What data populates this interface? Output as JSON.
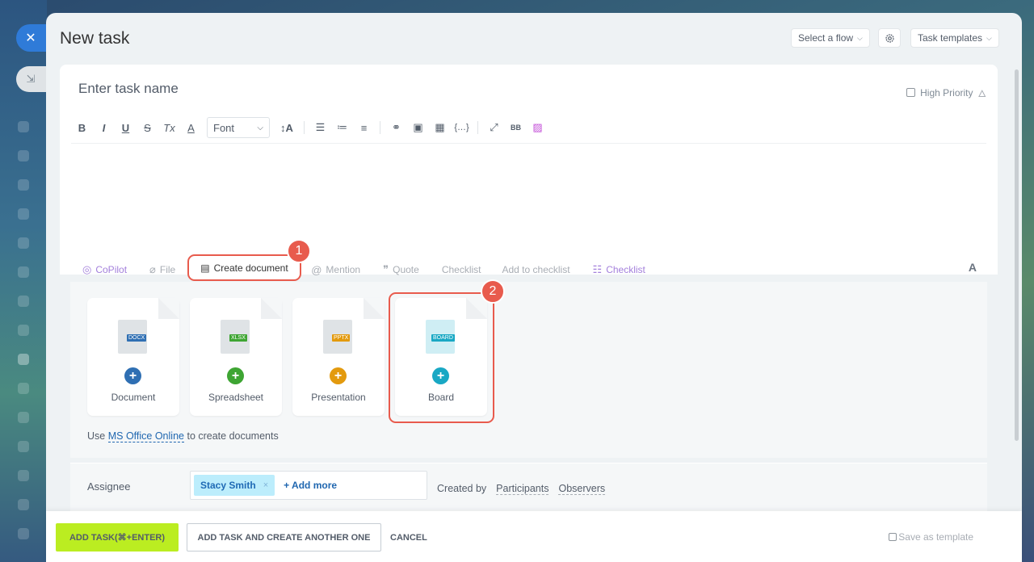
{
  "header": {
    "title": "New task",
    "select_flow": "Select a flow",
    "task_templates": "Task templates"
  },
  "sidebar": {
    "close_icon": "close-icon",
    "collapse_icon": "collapse-icon"
  },
  "editor": {
    "task_name_placeholder": "Enter task name",
    "high_priority": "High Priority",
    "toolbar": {
      "bold": "B",
      "italic": "I",
      "underline": "U",
      "strike": "S",
      "clear_format": "Tx",
      "text_color": "A",
      "font": "Font",
      "font_size": "↕A",
      "bbcode": "BB"
    }
  },
  "actions": {
    "copilot": "CoPilot",
    "file": "File",
    "create_document": "Create document",
    "mention": "Mention",
    "quote": "Quote",
    "checklist": "Checklist",
    "add_to_checklist": "Add to checklist",
    "checklist_new": "Checklist",
    "font_size": "A"
  },
  "documents": {
    "tiles": [
      {
        "label": "Document",
        "ext": "DOCX",
        "color": "#2f6fb3"
      },
      {
        "label": "Spreadsheet",
        "ext": "XLSX",
        "color": "#3ea533"
      },
      {
        "label": "Presentation",
        "ext": "PPTX",
        "color": "#e39a0e"
      },
      {
        "label": "Board",
        "ext": "BOARD",
        "color": "#19a8c4"
      }
    ],
    "note_prefix": "Use",
    "note_link": "MS Office Online",
    "note_suffix": "to create documents"
  },
  "annotations": {
    "badge1": "1",
    "badge2": "2"
  },
  "assignee": {
    "label": "Assignee",
    "chip": "Stacy Smith",
    "chip_remove": "×",
    "add_more": "+ Add more",
    "created_by": "Created by",
    "participants": "Participants",
    "observers": "Observers"
  },
  "footer": {
    "add_task": "ADD TASK(⌘+ENTER)",
    "add_another": "ADD TASK AND CREATE ANOTHER ONE",
    "cancel": "CANCEL",
    "save_template": "Save as template"
  }
}
